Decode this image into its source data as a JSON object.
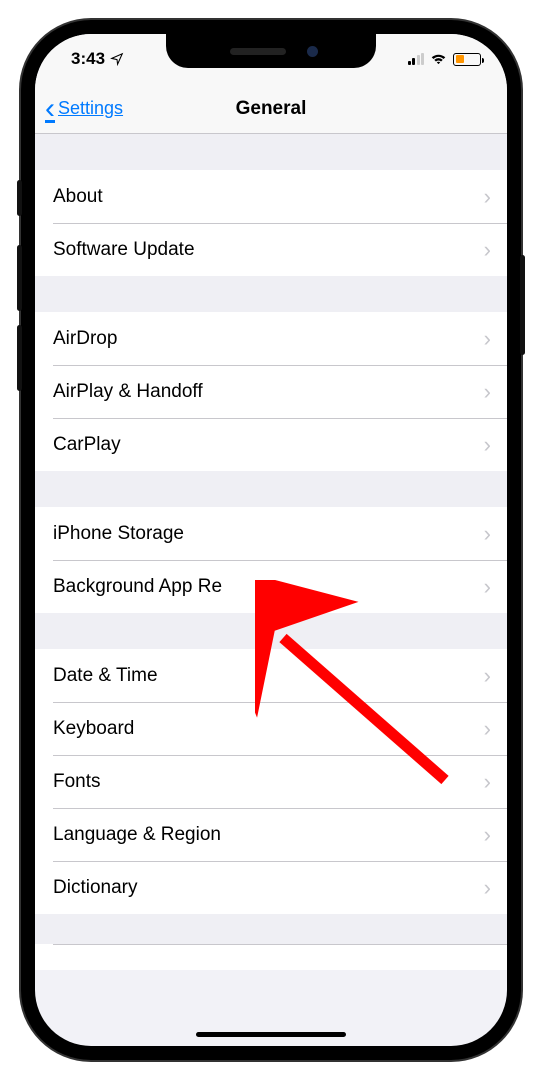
{
  "statusbar": {
    "time": "3:43"
  },
  "nav": {
    "back_label": "Settings",
    "title": "General"
  },
  "groups": [
    {
      "items": [
        {
          "id": "about",
          "label": "About"
        },
        {
          "id": "software-update",
          "label": "Software Update"
        }
      ]
    },
    {
      "items": [
        {
          "id": "airdrop",
          "label": "AirDrop"
        },
        {
          "id": "airplay-handoff",
          "label": "AirPlay & Handoff"
        },
        {
          "id": "carplay",
          "label": "CarPlay"
        }
      ]
    },
    {
      "items": [
        {
          "id": "iphone-storage",
          "label": "iPhone Storage"
        },
        {
          "id": "background-app-refresh",
          "label": "Background App Re"
        }
      ]
    },
    {
      "items": [
        {
          "id": "date-time",
          "label": "Date & Time"
        },
        {
          "id": "keyboard",
          "label": "Keyboard"
        },
        {
          "id": "fonts",
          "label": "Fonts"
        },
        {
          "id": "language-region",
          "label": "Language & Region"
        },
        {
          "id": "dictionary",
          "label": "Dictionary"
        }
      ]
    }
  ],
  "partial": {
    "left": "",
    "right": ""
  }
}
